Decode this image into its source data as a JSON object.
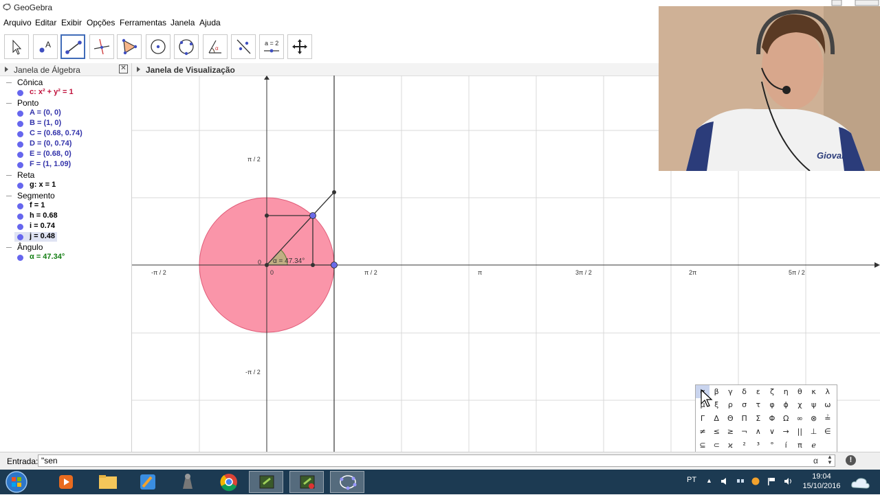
{
  "window": {
    "title": "GeoGebra"
  },
  "menu": [
    "Arquivo",
    "Editar",
    "Exibir",
    "Opções",
    "Ferramentas",
    "Janela",
    "Ajuda"
  ],
  "algebra": {
    "header": "Janela de Álgebra",
    "categories": [
      {
        "name": "Cônica",
        "items": [
          {
            "text": "c: x² + y² = 1",
            "color": "#c0123c"
          }
        ]
      },
      {
        "name": "Ponto",
        "items": [
          {
            "text": "A = (0, 0)",
            "color": "#3333aa"
          },
          {
            "text": "B = (1, 0)",
            "color": "#3333aa"
          },
          {
            "text": "C = (0.68, 0.74)",
            "color": "#3333aa"
          },
          {
            "text": "D = (0, 0.74)",
            "color": "#3333aa"
          },
          {
            "text": "E = (0.68, 0)",
            "color": "#3333aa"
          },
          {
            "text": "F = (1, 1.09)",
            "color": "#3333aa"
          }
        ]
      },
      {
        "name": "Reta",
        "items": [
          {
            "text": "g: x = 1",
            "color": "#000000"
          }
        ]
      },
      {
        "name": "Segmento",
        "items": [
          {
            "text": "f = 1",
            "color": "#000000"
          },
          {
            "text": "h = 0.68",
            "color": "#000000"
          },
          {
            "text": "i = 0.74",
            "color": "#000000"
          },
          {
            "text": "j = 0.48",
            "color": "#000000"
          }
        ]
      },
      {
        "name": "Ângulo",
        "items": [
          {
            "text": "α = 47.34°",
            "color": "#127d12"
          }
        ]
      }
    ]
  },
  "graphics": {
    "header": "Janela de Visualização",
    "x_ticks": [
      "-π / 2",
      "0",
      "π / 2",
      "π",
      "3π / 2",
      "2π",
      "5π / 2"
    ],
    "y_ticks": [
      "π / 2",
      "-π / 2"
    ],
    "origin_label": "0",
    "angle_label": "α = 47.34°"
  },
  "input": {
    "label": "Entrada:",
    "value": "\"sen",
    "alpha": "α"
  },
  "greek_rows": [
    [
      "α",
      "β",
      "γ",
      "δ",
      "ε",
      "ζ",
      "η",
      "θ",
      "κ",
      "λ"
    ],
    [
      "μ",
      "ξ",
      "ρ",
      "σ",
      "τ",
      "φ",
      "ϕ",
      "χ",
      "ψ",
      "ω"
    ],
    [
      "Γ",
      "Δ",
      "Θ",
      "Π",
      "Σ",
      "Φ",
      "Ω",
      "∞",
      "⊗",
      "≟"
    ],
    [
      "≠",
      "≤",
      "≥",
      "¬",
      "∧",
      "∨",
      "→",
      "||",
      "⊥",
      "∈"
    ],
    [
      "⊆",
      "⊂",
      "ϰ",
      "²",
      "³",
      "°",
      "í",
      "π",
      "ℯ",
      ""
    ]
  ],
  "webcam": {
    "shirt_text": "Giovani"
  },
  "taskbar": {
    "language": "PT",
    "time": "19:04",
    "date": "15/10/2016"
  },
  "colors": {
    "accent": "#3f6bb8",
    "circle_fill": "#f98aa0",
    "point": "#6b6be8"
  }
}
